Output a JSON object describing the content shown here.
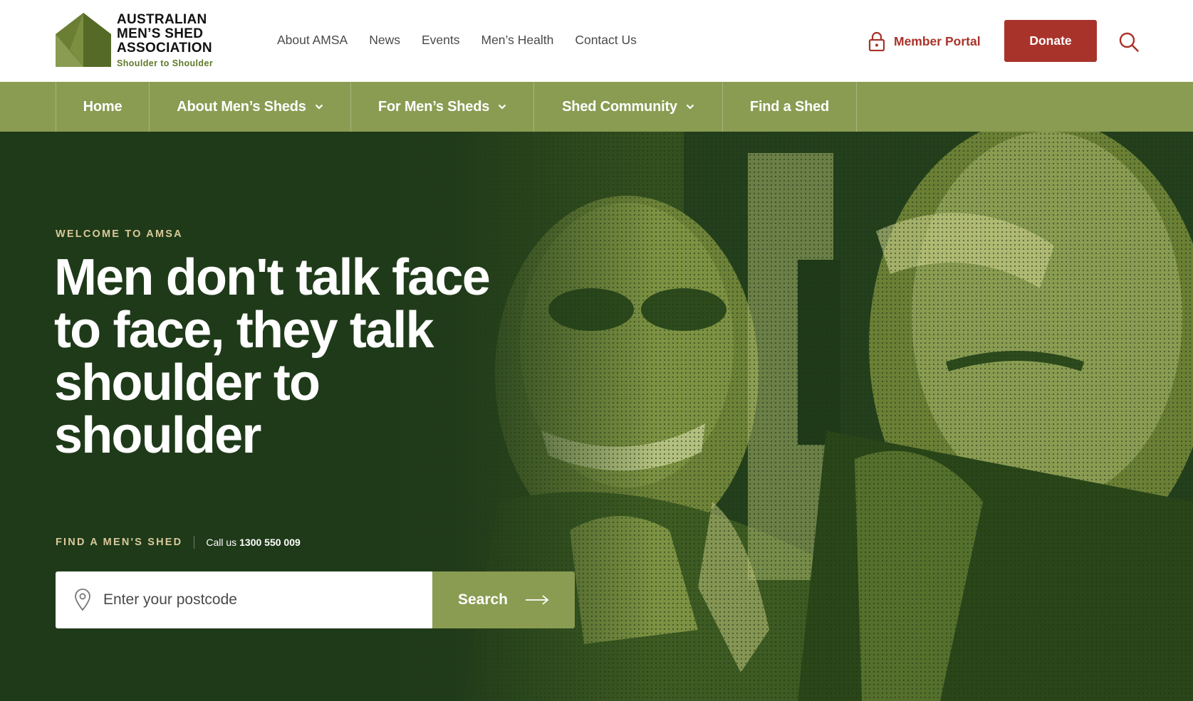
{
  "brand": {
    "name_lines": [
      "AUSTRALIAN",
      "MEN’S SHED",
      "ASSOCIATION"
    ],
    "tagline": "Shoulder to Shoulder",
    "colors": {
      "olive": "#8a9c52",
      "dark_green": "#203d1a",
      "red": "#a8332a",
      "cream": "#d9c99a"
    }
  },
  "utility_nav": [
    "About AMSA",
    "News",
    "Events",
    "Men’s Health",
    "Contact Us"
  ],
  "header_actions": {
    "member_portal": "Member Portal",
    "member_portal_icon": "lock-icon",
    "donate": "Donate",
    "search_icon": "search-icon"
  },
  "main_nav": [
    {
      "label": "Home",
      "has_dropdown": false
    },
    {
      "label": "About Men’s Sheds",
      "has_dropdown": true
    },
    {
      "label": "For Men’s Sheds",
      "has_dropdown": true
    },
    {
      "label": "Shed Community",
      "has_dropdown": true
    },
    {
      "label": "Find a Shed",
      "has_dropdown": false
    }
  ],
  "hero": {
    "eyebrow": "WELCOME TO AMSA",
    "headline": "Men don't talk face to face, they talk shoulder to shoulder",
    "find_label": "FIND A MEN'S SHED",
    "call_prefix": "Call us",
    "call_number": "1300 550 009",
    "postcode_placeholder": "Enter your postcode",
    "postcode_value": "",
    "search_button": "Search",
    "pin_icon": "location-pin-icon",
    "arrow_icon": "arrow-right-icon"
  }
}
